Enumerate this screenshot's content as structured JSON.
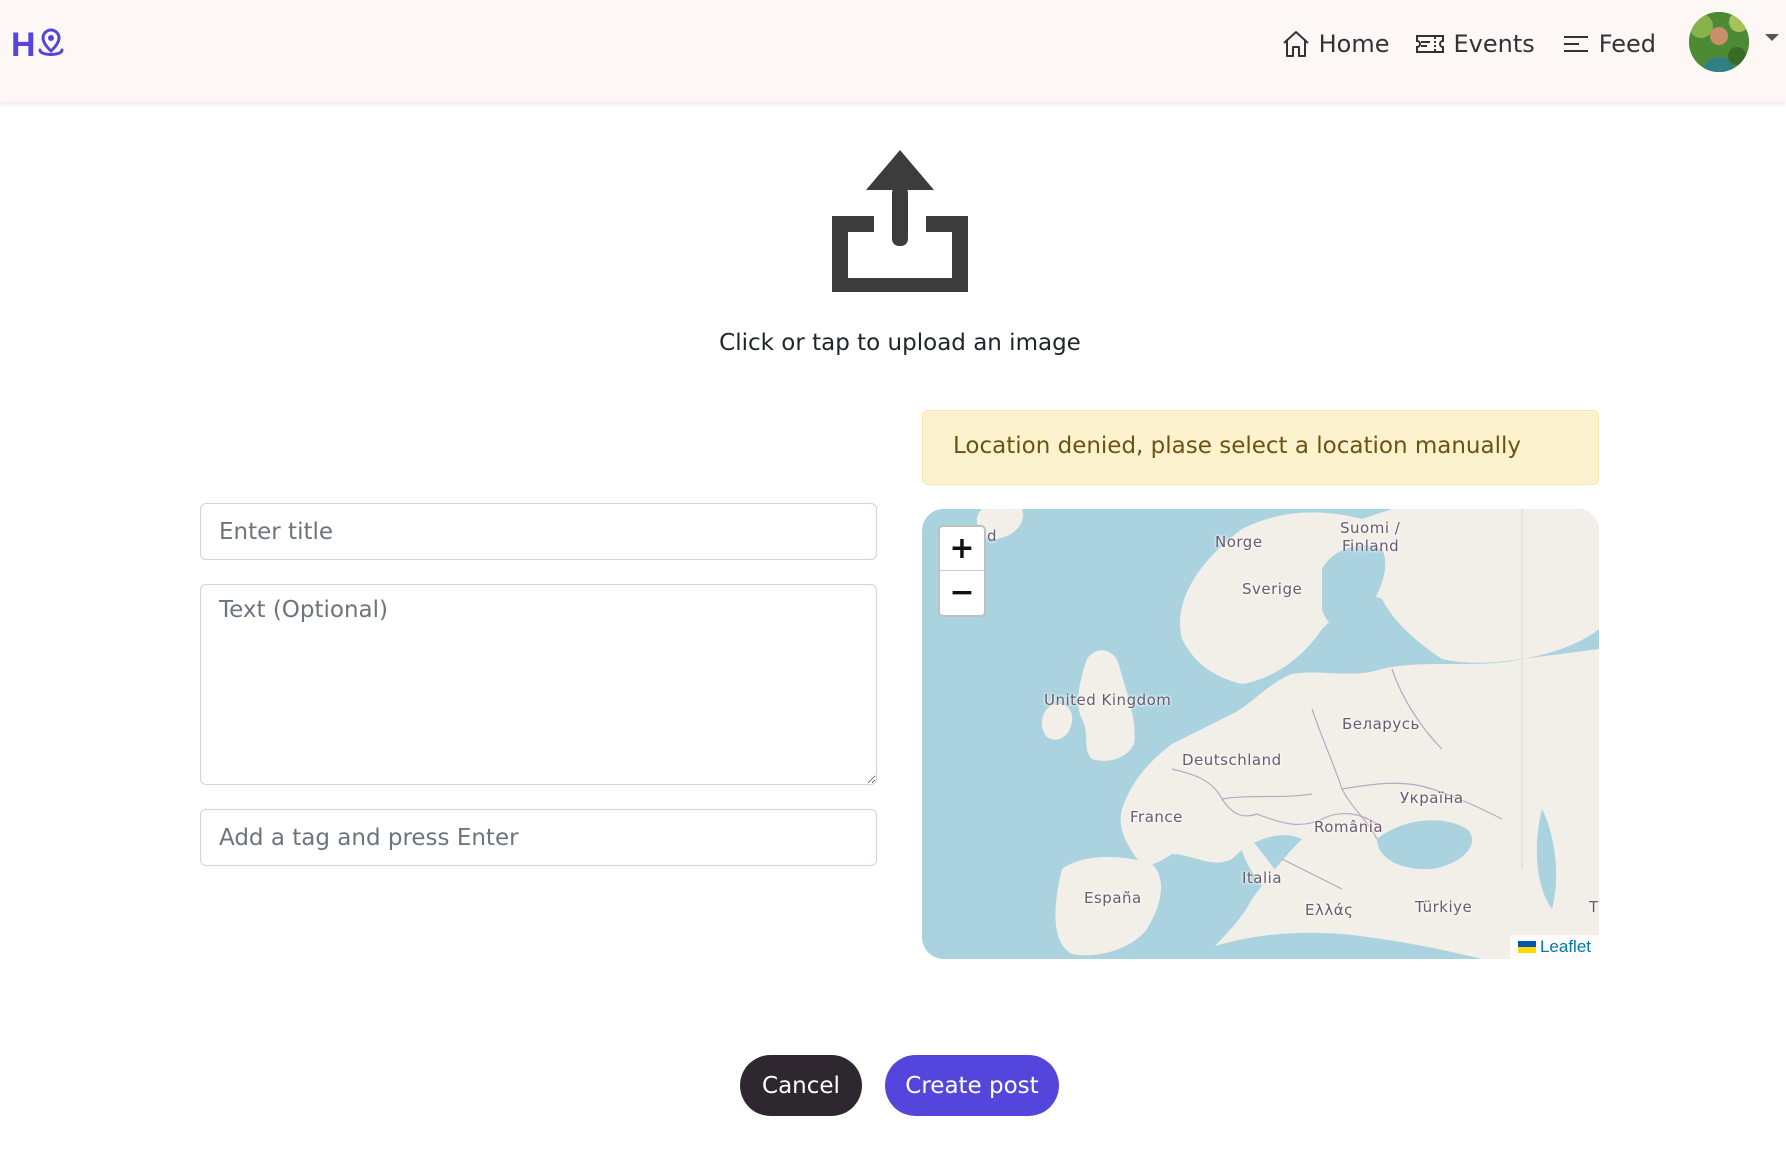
{
  "nav": {
    "logo_text": "H",
    "links": [
      {
        "label": "Home",
        "icon": "home-icon"
      },
      {
        "label": "Events",
        "icon": "ticket-icon"
      },
      {
        "label": "Feed",
        "icon": "feed-icon"
      }
    ],
    "avatar": "user-avatar",
    "colors": {
      "brand": "#5446dd",
      "navbar_bg": "#fdf8f6"
    }
  },
  "upload": {
    "icon": "upload-icon",
    "text": "Click or tap to upload an image"
  },
  "alert": {
    "text": "Location denied, plase select a location manually",
    "colors": {
      "bg": "#fcf2cd",
      "text": "#6a5313"
    }
  },
  "form": {
    "title_placeholder": "Enter title",
    "text_placeholder": "Text (Optional)",
    "tag_placeholder": "Add a tag and press Enter"
  },
  "map": {
    "zoom_in": "+",
    "zoom_out": "−",
    "attribution": "Leaflet",
    "labels": [
      "nd",
      "Norge",
      "Suomi /",
      "Finland",
      "Sverige",
      "United Kingdom",
      "Беларусь",
      "Deutschland",
      "Україна",
      "France",
      "România",
      "Italia",
      "España",
      "Ελλάς",
      "Türkiye",
      "T"
    ]
  },
  "buttons": {
    "cancel": "Cancel",
    "create": "Create post"
  }
}
